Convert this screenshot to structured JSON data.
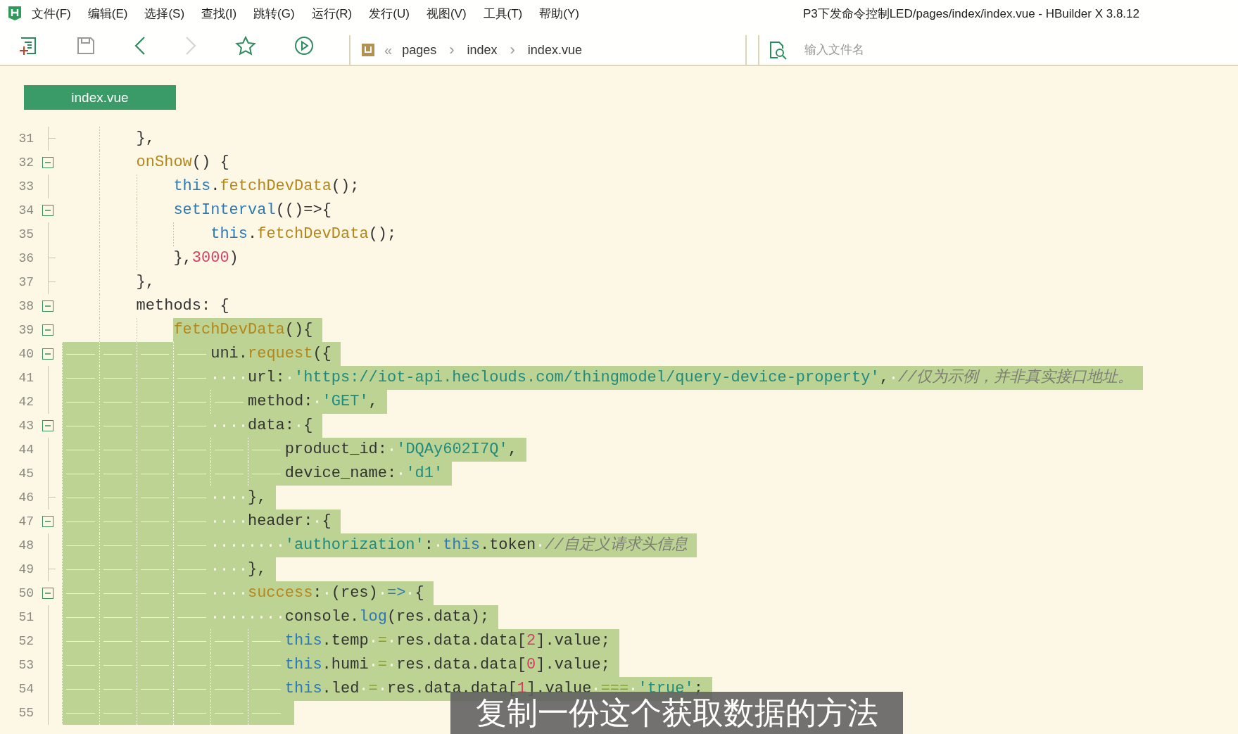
{
  "window": {
    "title": "P3下发命令控制LED/pages/index/index.vue - HBuilder X 3.8.12"
  },
  "menu": [
    "文件(F)",
    "编辑(E)",
    "选择(S)",
    "查找(I)",
    "跳转(G)",
    "运行(R)",
    "发行(U)",
    "视图(V)",
    "工具(T)",
    "帮助(Y)"
  ],
  "toolbar": [
    {
      "kind": "new-file",
      "disabled": false
    },
    {
      "kind": "save",
      "disabled": false
    },
    {
      "kind": "back",
      "disabled": false
    },
    {
      "kind": "forward",
      "disabled": true
    },
    {
      "kind": "favorite",
      "disabled": false
    },
    {
      "kind": "run",
      "disabled": false
    }
  ],
  "breadcrumb": {
    "back": "«",
    "items": [
      "pages",
      "index",
      "index.vue"
    ],
    "separator": "›"
  },
  "file_search": {
    "placeholder": "输入文件名"
  },
  "tabs": [
    {
      "label": "index.vue",
      "selected": true
    }
  ],
  "lines": [
    {
      "number": "31",
      "fold": {
        "kind": "end"
      },
      "selected": false,
      "indent_selected": false,
      "indent": [
        {
          "kind": "tab"
        },
        {
          "kind": "tab"
        }
      ],
      "tokens": [
        {
          "kind": "plain",
          "text": "},"
        }
      ]
    },
    {
      "number": "32",
      "fold": {
        "kind": "open"
      },
      "selected": false,
      "indent_selected": false,
      "indent": [
        {
          "kind": "tab"
        },
        {
          "kind": "tab"
        }
      ],
      "tokens": [
        {
          "kind": "func",
          "text": "onShow"
        },
        {
          "kind": "plain",
          "text": "() {"
        }
      ]
    },
    {
      "number": "33",
      "fold": {
        "kind": "line"
      },
      "selected": false,
      "indent_selected": false,
      "indent": [
        {
          "kind": "tab"
        },
        {
          "kind": "tab"
        },
        {
          "kind": "tab"
        }
      ],
      "tokens": [
        {
          "kind": "keyword",
          "text": "this"
        },
        {
          "kind": "plain",
          "text": "."
        },
        {
          "kind": "func",
          "text": "fetchDevData"
        },
        {
          "kind": "plain",
          "text": "();"
        }
      ]
    },
    {
      "number": "34",
      "fold": {
        "kind": "open"
      },
      "selected": false,
      "indent_selected": false,
      "indent": [
        {
          "kind": "tab"
        },
        {
          "kind": "tab"
        },
        {
          "kind": "tab"
        }
      ],
      "tokens": [
        {
          "kind": "keyword",
          "text": "setInterval"
        },
        {
          "kind": "plain",
          "text": "(()=>{"
        }
      ]
    },
    {
      "number": "35",
      "fold": {
        "kind": "line"
      },
      "selected": false,
      "indent_selected": false,
      "indent": [
        {
          "kind": "tab"
        },
        {
          "kind": "tab"
        },
        {
          "kind": "tab"
        },
        {
          "kind": "tab"
        }
      ],
      "tokens": [
        {
          "kind": "keyword",
          "text": "this"
        },
        {
          "kind": "plain",
          "text": "."
        },
        {
          "kind": "func",
          "text": "fetchDevData"
        },
        {
          "kind": "plain",
          "text": "();"
        }
      ]
    },
    {
      "number": "36",
      "fold": {
        "kind": "end"
      },
      "selected": false,
      "indent_selected": false,
      "indent": [
        {
          "kind": "tab"
        },
        {
          "kind": "tab"
        },
        {
          "kind": "tab"
        }
      ],
      "tokens": [
        {
          "kind": "plain",
          "text": "},"
        },
        {
          "kind": "number",
          "text": "3000"
        },
        {
          "kind": "plain",
          "text": ")"
        }
      ]
    },
    {
      "number": "37",
      "fold": {
        "kind": "end"
      },
      "selected": false,
      "indent_selected": false,
      "indent": [
        {
          "kind": "tab"
        },
        {
          "kind": "tab"
        }
      ],
      "tokens": [
        {
          "kind": "plain",
          "text": "},"
        }
      ]
    },
    {
      "number": "38",
      "fold": {
        "kind": "open"
      },
      "selected": false,
      "indent_selected": false,
      "indent": [
        {
          "kind": "tab"
        },
        {
          "kind": "tab"
        }
      ],
      "tokens": [
        {
          "kind": "plain",
          "text": "methods: {"
        }
      ]
    },
    {
      "number": "39",
      "fold": {
        "kind": "open"
      },
      "selected": true,
      "indent_selected": false,
      "indent": [
        {
          "kind": "tab"
        },
        {
          "kind": "tab"
        },
        {
          "kind": "tab"
        }
      ],
      "tokens": [
        {
          "kind": "func",
          "text": "fetchDevData"
        },
        {
          "kind": "plain",
          "text": "(){"
        }
      ]
    },
    {
      "number": "40",
      "fold": {
        "kind": "open"
      },
      "selected": true,
      "indent_selected": true,
      "indent": [
        {
          "kind": "tab"
        },
        {
          "kind": "tab"
        },
        {
          "kind": "tab"
        },
        {
          "kind": "tab"
        }
      ],
      "tokens": [
        {
          "kind": "plain",
          "text": "uni."
        },
        {
          "kind": "func",
          "text": "request"
        },
        {
          "kind": "plain",
          "text": "({"
        }
      ]
    },
    {
      "number": "41",
      "fold": {
        "kind": "line"
      },
      "selected": true,
      "indent_selected": true,
      "indent": [
        {
          "kind": "tab"
        },
        {
          "kind": "tab"
        },
        {
          "kind": "tab"
        },
        {
          "kind": "tab"
        },
        {
          "kind": "space"
        },
        {
          "kind": "space"
        },
        {
          "kind": "space"
        },
        {
          "kind": "space"
        }
      ],
      "tokens": [
        {
          "kind": "plain",
          "text": "url: "
        },
        {
          "kind": "string",
          "text": "'https://iot-api.heclouds.com/thingmodel/query-device-property'"
        },
        {
          "kind": "plain",
          "text": ", "
        },
        {
          "kind": "comment",
          "text": "//仅为示例，并非真实接口地址。"
        }
      ]
    },
    {
      "number": "42",
      "fold": {
        "kind": "line"
      },
      "selected": true,
      "indent_selected": true,
      "indent": [
        {
          "kind": "tab"
        },
        {
          "kind": "tab"
        },
        {
          "kind": "tab"
        },
        {
          "kind": "tab"
        },
        {
          "kind": "tab"
        }
      ],
      "tokens": [
        {
          "kind": "plain",
          "text": "method: "
        },
        {
          "kind": "string",
          "text": "'GET'"
        },
        {
          "kind": "plain",
          "text": ","
        }
      ]
    },
    {
      "number": "43",
      "fold": {
        "kind": "open"
      },
      "selected": true,
      "indent_selected": true,
      "indent": [
        {
          "kind": "tab"
        },
        {
          "kind": "tab"
        },
        {
          "kind": "tab"
        },
        {
          "kind": "tab"
        },
        {
          "kind": "space"
        },
        {
          "kind": "space"
        },
        {
          "kind": "space"
        },
        {
          "kind": "space"
        }
      ],
      "tokens": [
        {
          "kind": "plain",
          "text": "data: {"
        }
      ]
    },
    {
      "number": "44",
      "fold": {
        "kind": "line"
      },
      "selected": true,
      "indent_selected": true,
      "indent": [
        {
          "kind": "tab"
        },
        {
          "kind": "tab"
        },
        {
          "kind": "tab"
        },
        {
          "kind": "tab"
        },
        {
          "kind": "tab"
        },
        {
          "kind": "tab"
        }
      ],
      "tokens": [
        {
          "kind": "plain",
          "text": "product_id: "
        },
        {
          "kind": "string",
          "text": "'DQAy602I7Q'"
        },
        {
          "kind": "plain",
          "text": ","
        }
      ]
    },
    {
      "number": "45",
      "fold": {
        "kind": "line"
      },
      "selected": true,
      "indent_selected": true,
      "indent": [
        {
          "kind": "tab"
        },
        {
          "kind": "tab"
        },
        {
          "kind": "tab"
        },
        {
          "kind": "tab"
        },
        {
          "kind": "tab"
        },
        {
          "kind": "tab"
        }
      ],
      "tokens": [
        {
          "kind": "plain",
          "text": "device_name: "
        },
        {
          "kind": "string",
          "text": "'d1'"
        }
      ]
    },
    {
      "number": "46",
      "fold": {
        "kind": "end"
      },
      "selected": true,
      "indent_selected": true,
      "indent": [
        {
          "kind": "tab"
        },
        {
          "kind": "tab"
        },
        {
          "kind": "tab"
        },
        {
          "kind": "tab"
        },
        {
          "kind": "space"
        },
        {
          "kind": "space"
        },
        {
          "kind": "space"
        },
        {
          "kind": "space"
        }
      ],
      "tokens": [
        {
          "kind": "plain",
          "text": "},"
        }
      ]
    },
    {
      "number": "47",
      "fold": {
        "kind": "open"
      },
      "selected": true,
      "indent_selected": true,
      "indent": [
        {
          "kind": "tab"
        },
        {
          "kind": "tab"
        },
        {
          "kind": "tab"
        },
        {
          "kind": "tab"
        },
        {
          "kind": "space"
        },
        {
          "kind": "space"
        },
        {
          "kind": "space"
        },
        {
          "kind": "space"
        }
      ],
      "tokens": [
        {
          "kind": "plain",
          "text": "header: {"
        }
      ]
    },
    {
      "number": "48",
      "fold": {
        "kind": "line"
      },
      "selected": true,
      "indent_selected": true,
      "indent": [
        {
          "kind": "tab"
        },
        {
          "kind": "tab"
        },
        {
          "kind": "tab"
        },
        {
          "kind": "tab"
        },
        {
          "kind": "space"
        },
        {
          "kind": "space"
        },
        {
          "kind": "space"
        },
        {
          "kind": "space"
        },
        {
          "kind": "space"
        },
        {
          "kind": "space"
        },
        {
          "kind": "space"
        },
        {
          "kind": "space"
        }
      ],
      "tokens": [
        {
          "kind": "string",
          "text": "'authorization'"
        },
        {
          "kind": "plain",
          "text": ": "
        },
        {
          "kind": "keyword",
          "text": "this"
        },
        {
          "kind": "plain",
          "text": ".token "
        },
        {
          "kind": "comment",
          "text": "//自定义请求头信息"
        }
      ]
    },
    {
      "number": "49",
      "fold": {
        "kind": "end"
      },
      "selected": true,
      "indent_selected": true,
      "indent": [
        {
          "kind": "tab"
        },
        {
          "kind": "tab"
        },
        {
          "kind": "tab"
        },
        {
          "kind": "tab"
        },
        {
          "kind": "space"
        },
        {
          "kind": "space"
        },
        {
          "kind": "space"
        },
        {
          "kind": "space"
        }
      ],
      "tokens": [
        {
          "kind": "plain",
          "text": "},"
        }
      ]
    },
    {
      "number": "50",
      "fold": {
        "kind": "open"
      },
      "selected": true,
      "indent_selected": true,
      "indent": [
        {
          "kind": "tab"
        },
        {
          "kind": "tab"
        },
        {
          "kind": "tab"
        },
        {
          "kind": "tab"
        },
        {
          "kind": "space"
        },
        {
          "kind": "space"
        },
        {
          "kind": "space"
        },
        {
          "kind": "space"
        }
      ],
      "tokens": [
        {
          "kind": "func",
          "text": "success"
        },
        {
          "kind": "plain",
          "text": ": (res) "
        },
        {
          "kind": "keyword",
          "text": "=>"
        },
        {
          "kind": "plain",
          "text": " {"
        }
      ]
    },
    {
      "number": "51",
      "fold": {
        "kind": "line"
      },
      "selected": true,
      "indent_selected": true,
      "indent": [
        {
          "kind": "tab"
        },
        {
          "kind": "tab"
        },
        {
          "kind": "tab"
        },
        {
          "kind": "tab"
        },
        {
          "kind": "space"
        },
        {
          "kind": "space"
        },
        {
          "kind": "space"
        },
        {
          "kind": "space"
        },
        {
          "kind": "space"
        },
        {
          "kind": "space"
        },
        {
          "kind": "space"
        },
        {
          "kind": "space"
        }
      ],
      "tokens": [
        {
          "kind": "plain",
          "text": "console."
        },
        {
          "kind": "keyword",
          "text": "log"
        },
        {
          "kind": "plain",
          "text": "(res.data);"
        }
      ]
    },
    {
      "number": "52",
      "fold": {
        "kind": "line"
      },
      "selected": true,
      "indent_selected": true,
      "indent": [
        {
          "kind": "tab"
        },
        {
          "kind": "tab"
        },
        {
          "kind": "tab"
        },
        {
          "kind": "tab"
        },
        {
          "kind": "tab"
        },
        {
          "kind": "tab"
        }
      ],
      "tokens": [
        {
          "kind": "keyword",
          "text": "this"
        },
        {
          "kind": "plain",
          "text": ".temp "
        },
        {
          "kind": "operator",
          "text": "="
        },
        {
          "kind": "plain",
          "text": " res.data.data["
        },
        {
          "kind": "number",
          "text": "2"
        },
        {
          "kind": "plain",
          "text": "].value;"
        }
      ]
    },
    {
      "number": "53",
      "fold": {
        "kind": "line"
      },
      "selected": true,
      "indent_selected": true,
      "indent": [
        {
          "kind": "tab"
        },
        {
          "kind": "tab"
        },
        {
          "kind": "tab"
        },
        {
          "kind": "tab"
        },
        {
          "kind": "tab"
        },
        {
          "kind": "tab"
        }
      ],
      "tokens": [
        {
          "kind": "keyword",
          "text": "this"
        },
        {
          "kind": "plain",
          "text": ".humi "
        },
        {
          "kind": "operator",
          "text": "="
        },
        {
          "kind": "plain",
          "text": " res.data.data["
        },
        {
          "kind": "number",
          "text": "0"
        },
        {
          "kind": "plain",
          "text": "].value;"
        }
      ]
    },
    {
      "number": "54",
      "fold": {
        "kind": "line"
      },
      "selected": true,
      "indent_selected": true,
      "indent": [
        {
          "kind": "tab"
        },
        {
          "kind": "tab"
        },
        {
          "kind": "tab"
        },
        {
          "kind": "tab"
        },
        {
          "kind": "tab"
        },
        {
          "kind": "tab"
        }
      ],
      "tokens": [
        {
          "kind": "keyword",
          "text": "this"
        },
        {
          "kind": "plain",
          "text": ".led "
        },
        {
          "kind": "operator",
          "text": "="
        },
        {
          "kind": "plain",
          "text": " res.data.data["
        },
        {
          "kind": "number",
          "text": "1"
        },
        {
          "kind": "plain",
          "text": "].value "
        },
        {
          "kind": "operator",
          "text": "==="
        },
        {
          "kind": "string",
          "text": " 'true'"
        },
        {
          "kind": "plain",
          "text": ";"
        }
      ]
    },
    {
      "number": "55",
      "fold": {
        "kind": "line"
      },
      "selected": true,
      "indent_selected": true,
      "indent": [
        {
          "kind": "tab"
        },
        {
          "kind": "tab"
        },
        {
          "kind": "tab"
        },
        {
          "kind": "tab"
        },
        {
          "kind": "tab"
        },
        {
          "kind": "tab"
        }
      ]
    }
  ],
  "subtitle": "复制一份这个获取数据的方法"
}
